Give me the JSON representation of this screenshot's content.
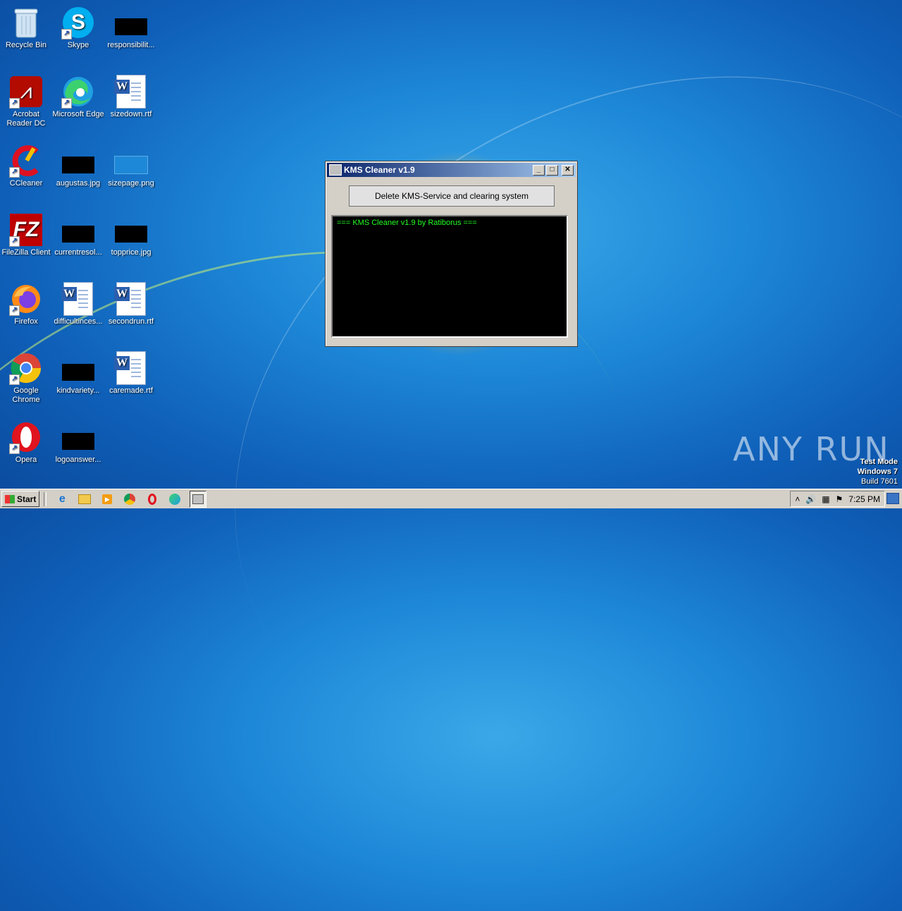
{
  "desktop": {
    "icons": [
      {
        "label": "Recycle Bin"
      },
      {
        "label": "Skype"
      },
      {
        "label": "responsibilit..."
      },
      {
        "label": "Acrobat Reader DC"
      },
      {
        "label": "Microsoft Edge"
      },
      {
        "label": "sizedown.rtf"
      },
      {
        "label": "CCleaner"
      },
      {
        "label": "augustas.jpg"
      },
      {
        "label": "sizepage.png"
      },
      {
        "label": "FileZilla Client"
      },
      {
        "label": "currentresol..."
      },
      {
        "label": "topprice.jpg"
      },
      {
        "label": "Firefox"
      },
      {
        "label": "difficultinces..."
      },
      {
        "label": "secondrun.rtf"
      },
      {
        "label": "Google Chrome"
      },
      {
        "label": "kindvariety..."
      },
      {
        "label": "caremade.rtf"
      },
      {
        "label": "Opera"
      },
      {
        "label": "logoanswer..."
      }
    ]
  },
  "window": {
    "title": "KMS Cleaner v1.9",
    "button_label": "Delete KMS-Service and clearing system",
    "console_text": "=== KMS Cleaner v1.9 by Ratiborus ===",
    "console_color": "#22ff22"
  },
  "watermark": {
    "text": "ANY RUN"
  },
  "test_mode": {
    "line1": "Test Mode",
    "line2": "Windows 7",
    "line3": "Build 7601"
  },
  "taskbar": {
    "start_label": "Start",
    "pinned": [
      "ie-icon",
      "explorer-icon",
      "media-player-icon",
      "chrome-icon",
      "opera-icon",
      "edge-icon",
      "kms-cleaner-icon"
    ],
    "clock": "7:25 PM"
  }
}
